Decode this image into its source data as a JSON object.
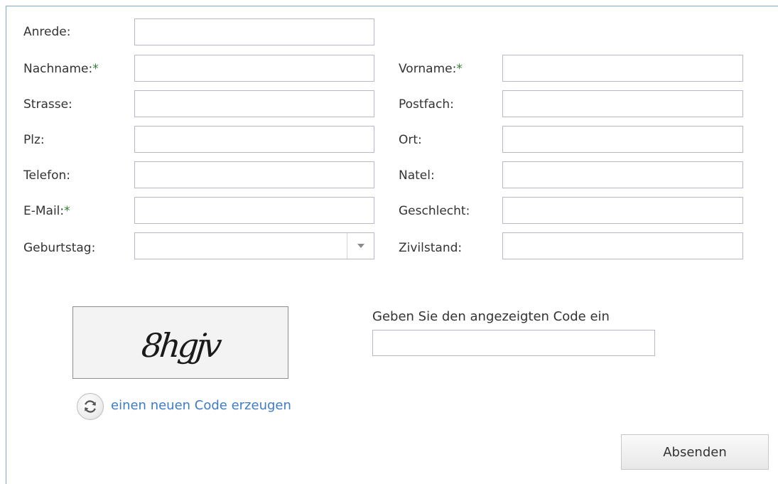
{
  "form": {
    "anrede": {
      "label": "Anrede:",
      "value": ""
    },
    "nachname": {
      "label": "Nachname:",
      "required": "*",
      "value": ""
    },
    "vorname": {
      "label": "Vorname:",
      "required": "*",
      "value": ""
    },
    "strasse": {
      "label": "Strasse:",
      "value": ""
    },
    "postfach": {
      "label": "Postfach:",
      "value": ""
    },
    "plz": {
      "label": "Plz:",
      "value": ""
    },
    "ort": {
      "label": "Ort:",
      "value": ""
    },
    "telefon": {
      "label": "Telefon:",
      "value": ""
    },
    "natel": {
      "label": "Natel:",
      "value": ""
    },
    "email": {
      "label": "E-Mail:",
      "required": "*",
      "value": ""
    },
    "geschlecht": {
      "label": "Geschlecht:",
      "value": ""
    },
    "geburtstag": {
      "label": "Geburtstag:",
      "value": ""
    },
    "zivilstand": {
      "label": "Zivilstand:",
      "value": ""
    }
  },
  "captcha": {
    "image_text": "8hgjv",
    "prompt": "Geben Sie den angezeigten Code ein",
    "value": "",
    "refresh_label": "einen neuen Code erzeugen",
    "refresh_icon": "refresh-icon"
  },
  "submit_label": "Absenden",
  "colors": {
    "frame_border": "#7fa6d1",
    "required_marker": "#2e7d32",
    "link": "#3d7bc7",
    "field_border": "#b5b8c8"
  }
}
